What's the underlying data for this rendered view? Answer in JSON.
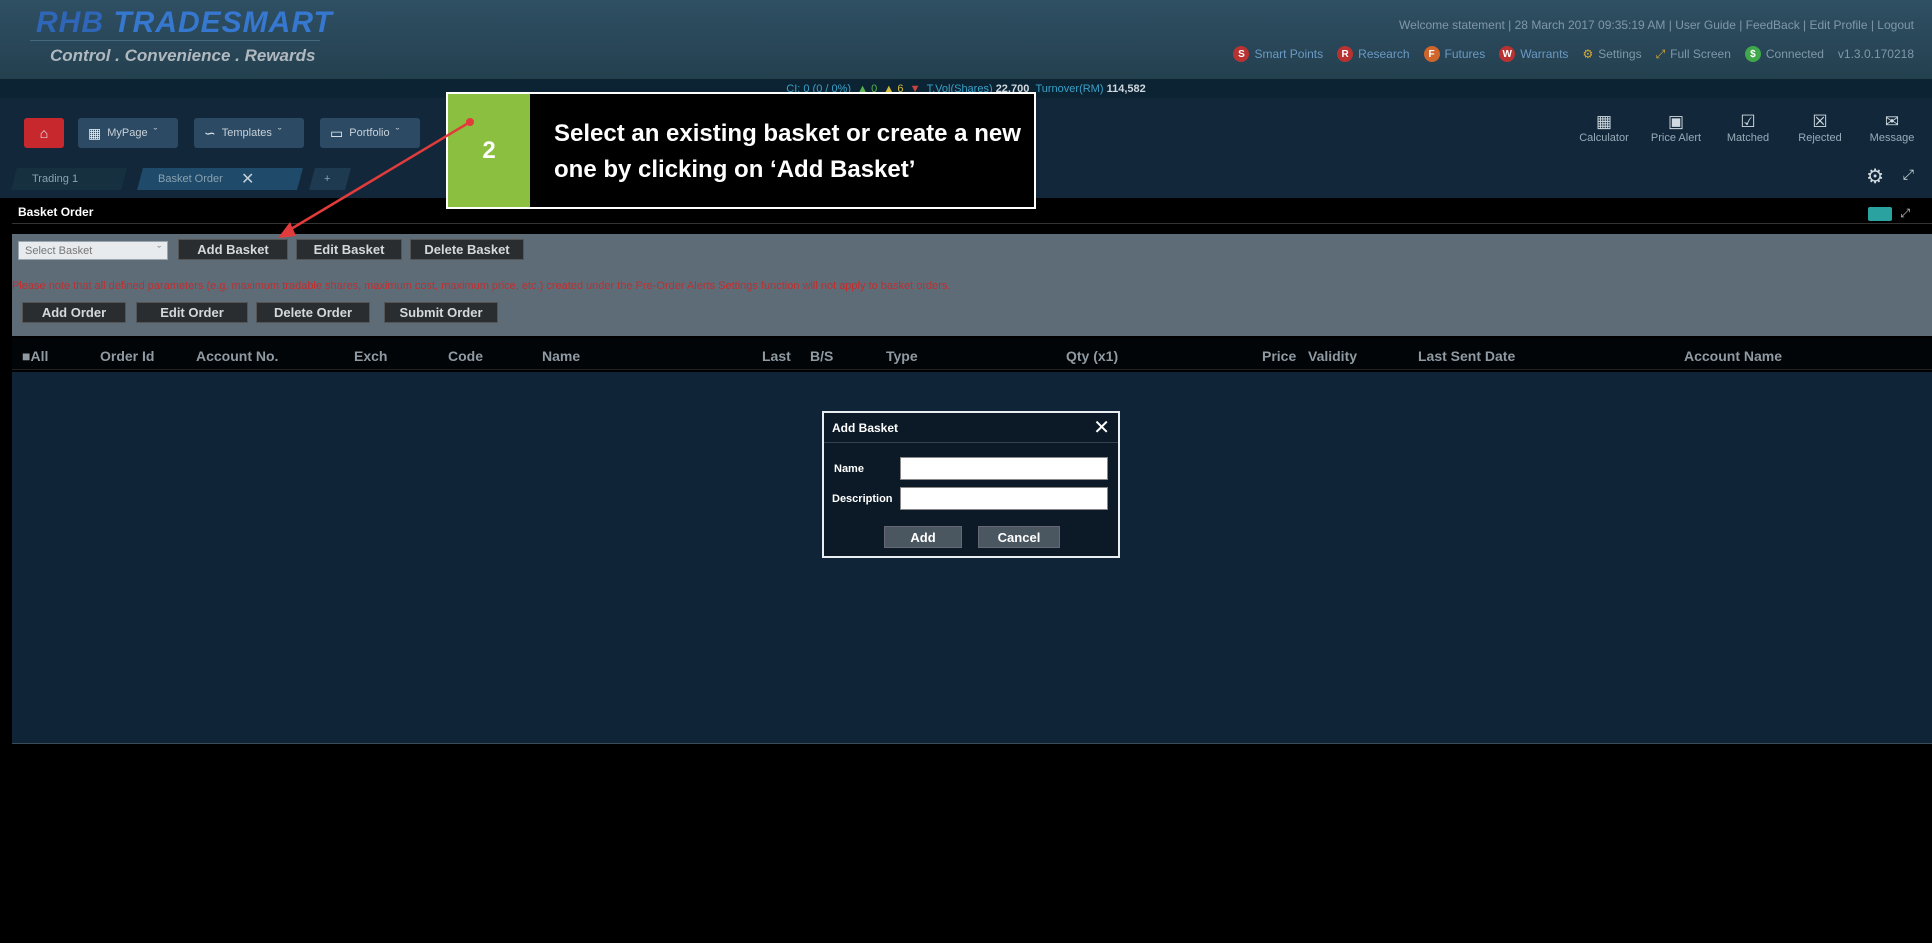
{
  "header": {
    "logo_left": "RHB",
    "logo_right": "TRADESMART",
    "tagline": "Control . Convenience . Rewards",
    "topright": "Welcome statement | 28 March 2017 09:35:19 AM | User Guide | FeedBack | Edit Profile | Logout",
    "top_tools": [
      {
        "badge": "S",
        "label": "Smart Points"
      },
      {
        "badge": "R",
        "label": "Research"
      },
      {
        "badge": "F",
        "label": "Futures"
      },
      {
        "badge": "W",
        "label": "Warrants"
      },
      {
        "badge": "",
        "label": "Settings"
      },
      {
        "badge": "",
        "label": "Full Screen"
      },
      {
        "badge": "",
        "label": "Connected"
      },
      {
        "badge": "",
        "label": "v1.3.0.170218"
      }
    ],
    "accent_color": "#c7282d"
  },
  "ticker": {
    "ci": "CI: 0 (0 / 0%)",
    "up": "0",
    "unch": "6",
    "down": "",
    "tvol_label": "T.Vol(Shares)",
    "tvol": "22,700",
    "turnover_label": "Turnover(RM)",
    "turnover": "114,582"
  },
  "nav": {
    "items": [
      "MyPage",
      "Templates",
      "Portfolio"
    ],
    "tabs": [
      "Trading 1",
      "Basket Order"
    ],
    "right_items": [
      "Calculator",
      "Price Alert",
      "Matched",
      "Rejected",
      "Message"
    ]
  },
  "panel": {
    "title": "Basket Order",
    "select_placeholder": "Select Basket",
    "basket_buttons": [
      "Add Basket",
      "Edit Basket",
      "Delete Basket"
    ],
    "warning": "Please note that all defined parameters (e.g. maximum tradable shares, maximum cost, maximum price, etc.) created under the Pre-Order Alerts Settings function will not apply to basket orders.",
    "order_buttons": [
      "Add Order",
      "Edit Order",
      "Delete Order",
      "Submit Order"
    ],
    "columns": [
      "All",
      "Order Id",
      "Account No.",
      "Exch",
      "Code",
      "Name",
      "Last",
      "B/S",
      "Type",
      "Qty (x1)",
      "Price",
      "Validity",
      "Last Sent Date",
      "Account Name"
    ]
  },
  "dialog": {
    "title": "Add Basket",
    "name_label": "Name",
    "desc_label": "Description",
    "add": "Add",
    "cancel": "Cancel"
  },
  "callout": {
    "step": "2",
    "text": "Select an existing basket or create a new one by clicking on ‘Add Basket’",
    "badge_color": "#8bbf3f",
    "arrow_color": "#e23b3b"
  }
}
